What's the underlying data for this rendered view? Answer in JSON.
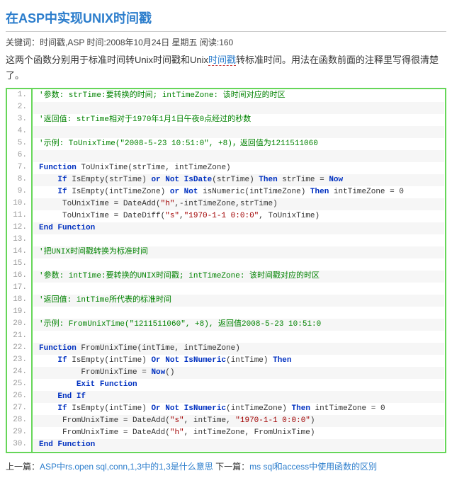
{
  "post": {
    "title": "在ASP中实现UNIX时间戳",
    "meta": "关键词：时间戳,ASP 时间:2008年10月24日 星期五 阅读:160",
    "desc_pre": "这两个函数分别用于标准时间转Unix时间戳和Unix",
    "desc_link": "时间戳",
    "desc_post": "转标准时间。用法在函数前面的注释里写得很清楚了。"
  },
  "nav": {
    "prev_label": "上一篇：",
    "prev_link": "ASP中rs.open sql,conn,1,3中的1,3是什么意思",
    "next_label": "下一篇：",
    "next_link": "ms sql和access中使用函数的区别"
  },
  "code_lines": [
    [
      [
        "c",
        "'参数: strTime:要转换的时间; intTimeZone: 该时间对应的时区"
      ]
    ],
    [],
    [
      [
        "c",
        "'返回值: strTime相对于1970年1月1日午夜0点经过的秒数"
      ]
    ],
    [],
    [
      [
        "c",
        "'示例: ToUnixTime(\"2008-5-23 10:51:0\", +8)，返回值为1211511060"
      ]
    ],
    [],
    [
      [
        "k",
        "Function"
      ],
      [
        "t",
        " ToUnixTime(strTime, intTimeZone)"
      ]
    ],
    [
      [
        "t",
        "    "
      ],
      [
        "k",
        "If"
      ],
      [
        "t",
        " IsEmpty(strTime) "
      ],
      [
        "k",
        "or"
      ],
      [
        "t",
        " "
      ],
      [
        "k",
        "Not"
      ],
      [
        "t",
        " "
      ],
      [
        "k",
        "IsDate"
      ],
      [
        "t",
        "(strTime) "
      ],
      [
        "k",
        "Then"
      ],
      [
        "t",
        " strTime = "
      ],
      [
        "k",
        "Now"
      ]
    ],
    [
      [
        "t",
        "    "
      ],
      [
        "k",
        "If"
      ],
      [
        "t",
        " IsEmpty(intTimeZone) "
      ],
      [
        "k",
        "or"
      ],
      [
        "t",
        " "
      ],
      [
        "k",
        "Not"
      ],
      [
        "t",
        " isNumeric(intTimeZone) "
      ],
      [
        "k",
        "Then"
      ],
      [
        "t",
        " intTimeZone = 0"
      ]
    ],
    [
      [
        "t",
        "     ToUnixTime = DateAdd("
      ],
      [
        "s",
        "\"h\""
      ],
      [
        "t",
        ",-intTimeZone,strTime)"
      ]
    ],
    [
      [
        "t",
        "     ToUnixTime = DateDiff("
      ],
      [
        "s",
        "\"s\""
      ],
      [
        "t",
        ","
      ],
      [
        "s",
        "\"1970-1-1 0:0:0\""
      ],
      [
        "t",
        ", ToUnixTime)"
      ]
    ],
    [
      [
        "k",
        "End"
      ],
      [
        "t",
        " "
      ],
      [
        "k",
        "Function"
      ]
    ],
    [],
    [
      [
        "c",
        "'把UNIX时间戳转换为标准时间"
      ]
    ],
    [],
    [
      [
        "c",
        "'参数: intTime:要转换的UNIX时间戳; intTimeZone: 该时间戳对应的时区"
      ]
    ],
    [],
    [
      [
        "c",
        "'返回值: intTime所代表的标准时间"
      ]
    ],
    [],
    [
      [
        "c",
        "'示例: FromUnixTime(\"1211511060\", +8), 返回值2008-5-23 10:51:0"
      ]
    ],
    [],
    [
      [
        "k",
        "Function"
      ],
      [
        "t",
        " FromUnixTime(intTime, intTimeZone)"
      ]
    ],
    [
      [
        "t",
        "    "
      ],
      [
        "k",
        "If"
      ],
      [
        "t",
        " IsEmpty(intTime) "
      ],
      [
        "k",
        "Or"
      ],
      [
        "t",
        " "
      ],
      [
        "k",
        "Not"
      ],
      [
        "t",
        " "
      ],
      [
        "k",
        "IsNumeric"
      ],
      [
        "t",
        "(intTime) "
      ],
      [
        "k",
        "Then"
      ]
    ],
    [
      [
        "t",
        "         FromUnixTime = "
      ],
      [
        "k",
        "Now"
      ],
      [
        "t",
        "()"
      ]
    ],
    [
      [
        "t",
        "        "
      ],
      [
        "k",
        "Exit"
      ],
      [
        "t",
        " "
      ],
      [
        "k",
        "Function"
      ]
    ],
    [
      [
        "t",
        "    "
      ],
      [
        "k",
        "End"
      ],
      [
        "t",
        " "
      ],
      [
        "k",
        "If"
      ]
    ],
    [
      [
        "t",
        "    "
      ],
      [
        "k",
        "If"
      ],
      [
        "t",
        " IsEmpty(intTime) "
      ],
      [
        "k",
        "Or"
      ],
      [
        "t",
        " "
      ],
      [
        "k",
        "Not"
      ],
      [
        "t",
        " "
      ],
      [
        "k",
        "IsNumeric"
      ],
      [
        "t",
        "(intTimeZone) "
      ],
      [
        "k",
        "Then"
      ],
      [
        "t",
        " intTimeZone = 0"
      ]
    ],
    [
      [
        "t",
        "     FromUnixTime = DateAdd("
      ],
      [
        "s",
        "\"s\""
      ],
      [
        "t",
        ", intTime, "
      ],
      [
        "s",
        "\"1970-1-1 0:0:0\""
      ],
      [
        "t",
        ")"
      ]
    ],
    [
      [
        "t",
        "     FromUnixTime = DateAdd("
      ],
      [
        "s",
        "\"h\""
      ],
      [
        "t",
        ", intTimeZone, FromUnixTime)"
      ]
    ],
    [
      [
        "k",
        "End"
      ],
      [
        "t",
        " "
      ],
      [
        "k",
        "Function"
      ]
    ]
  ]
}
